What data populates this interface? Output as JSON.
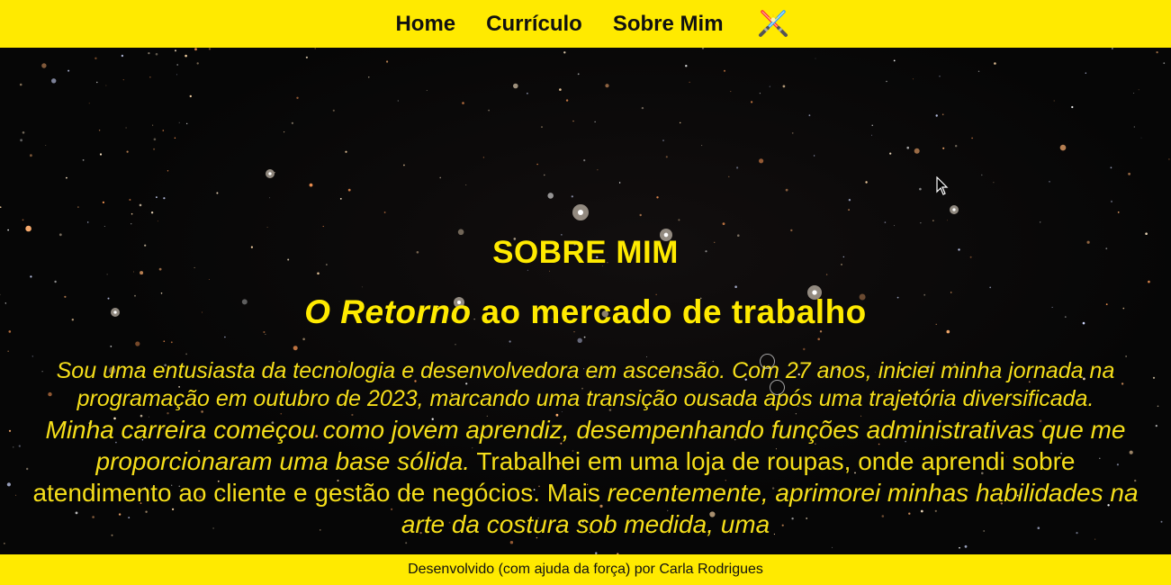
{
  "nav": {
    "items": [
      {
        "label": "Home"
      },
      {
        "label": "Currículo"
      },
      {
        "label": "Sobre Mim"
      }
    ],
    "icon": "lightsaber-icon"
  },
  "main": {
    "title": "SOBRE MIM",
    "subtitle_italic": "O Retorno",
    "subtitle_rest": "ao mercado de trabalho",
    "paragraph1": "Sou uma entusiasta da tecnologia e desenvolvedora em ascensão. Com 27 anos, iniciei minha jornada na programação em outubro de 2023, marcando uma transição ousada após uma trajetória diversificada.",
    "paragraph2_italic": "Minha carreira começou como jovem aprendiz, desempenhando funções administrativas que me proporcionaram uma base sólida.",
    "paragraph2_rest": "Trabalhei em uma loja de roupas, onde aprendi sobre atendimento ao cliente e gestão de negócios. Mais",
    "paragraph2_italic2": "recentemente, aprimorei minhas habilidades na arte da costura sob medida, uma"
  },
  "footer": {
    "text": "Desenvolvido (com ajuda da força) por Carla Rodrigues"
  },
  "colors": {
    "accent": "#ffea00",
    "background": "#060606",
    "text_dark": "#111111"
  }
}
